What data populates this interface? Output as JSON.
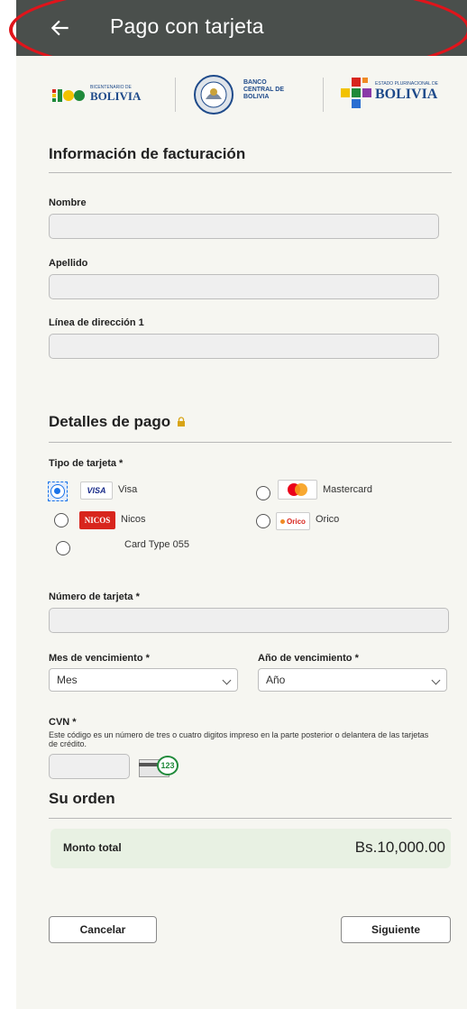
{
  "header": {
    "title": "Pago con tarjeta"
  },
  "logos": {
    "left_small": "BICENTENARIO DE",
    "left": "BOLIVIA",
    "center": "BANCO\nCENTRAL DE\nBOLIVIA",
    "right_small": "ESTADO PLURINACIONAL DE",
    "right": "BOLIVIA"
  },
  "billing": {
    "title": "Información de facturación",
    "first_name_label": "Nombre",
    "last_name_label": "Apellido",
    "address_label": "Línea de dirección 1"
  },
  "payment": {
    "title": "Detalles de pago",
    "card_type_label": "Tipo de tarjeta *",
    "card_types": [
      {
        "logo": "VISA",
        "name": "Visa",
        "selected": true
      },
      {
        "logo": "",
        "name": "Mastercard",
        "selected": false
      },
      {
        "logo": "NICOS",
        "name": "Nicos",
        "selected": false
      },
      {
        "logo": "Orico",
        "name": "Orico",
        "selected": false
      },
      {
        "logo": "",
        "name": "Card Type 055",
        "selected": false
      }
    ],
    "card_number_label": "Número de tarjeta *",
    "exp_month_label": "Mes de vencimiento *",
    "exp_month_value": "Mes",
    "exp_year_label": "Año de vencimiento *",
    "exp_year_value": "Año",
    "cvn_label": "CVN *",
    "cvn_help": "Este código es un número de tres o cuatro digitos impreso en la parte posterior o delantera de las tarjetas de crédito.",
    "cvn_sample": "123"
  },
  "order": {
    "title": "Su orden",
    "total_label": "Monto total",
    "total_value": "Bs.10,000.00"
  },
  "actions": {
    "cancel": "Cancelar",
    "next": "Siguiente"
  },
  "colors": {
    "header": "#4a4f4c",
    "highlight": "#e0141b",
    "background": "#f6f6f1",
    "total_bg": "#e8f1e3",
    "accent": "#1a73e8"
  }
}
